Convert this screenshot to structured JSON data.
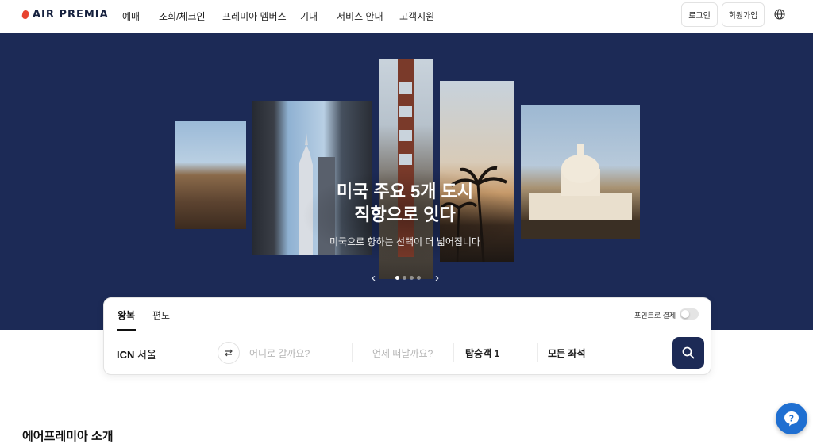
{
  "header": {
    "logo_text": "AIR PREMIA",
    "nav": [
      "예매",
      "조회/체크인",
      "프레미아 멤버스",
      "기내",
      "서비스 안내",
      "고객지원"
    ],
    "login_label": "로그인",
    "signup_label": "회원가입",
    "language_icon": "globe-icon"
  },
  "hero": {
    "title_line1": "미국 주요 5개 도시",
    "title_line2": "직항으로 잇다",
    "subtitle": "미국으로 향하는 선택이 더 넓어집니다",
    "slide_index": 1,
    "slide_count": 4,
    "photos": [
      "hollywood-sign",
      "new-york-chrysler",
      "golden-gate-bridge",
      "palm-trees",
      "us-capitol"
    ],
    "background_color": "#1c2a56"
  },
  "booking": {
    "tabs": [
      "왕복",
      "편도"
    ],
    "active_tab": "왕복",
    "points_label": "포인트로 결제",
    "points_toggle_on": false,
    "origin_code": "ICN",
    "origin_city": "서울",
    "destination_placeholder": "어디로 갈까요?",
    "date_placeholder": "언제 떠날까요?",
    "passengers": "탑승객 1",
    "seat_class": "모든 좌석",
    "search_icon": "search-icon"
  },
  "section": {
    "intro_title": "에어프레미아 소개"
  },
  "help": {
    "icon": "question-icon"
  },
  "colors": {
    "brand_navy": "#1c2a56",
    "logo_accent": "#e8432f",
    "help_blue": "#1f6fd1"
  }
}
